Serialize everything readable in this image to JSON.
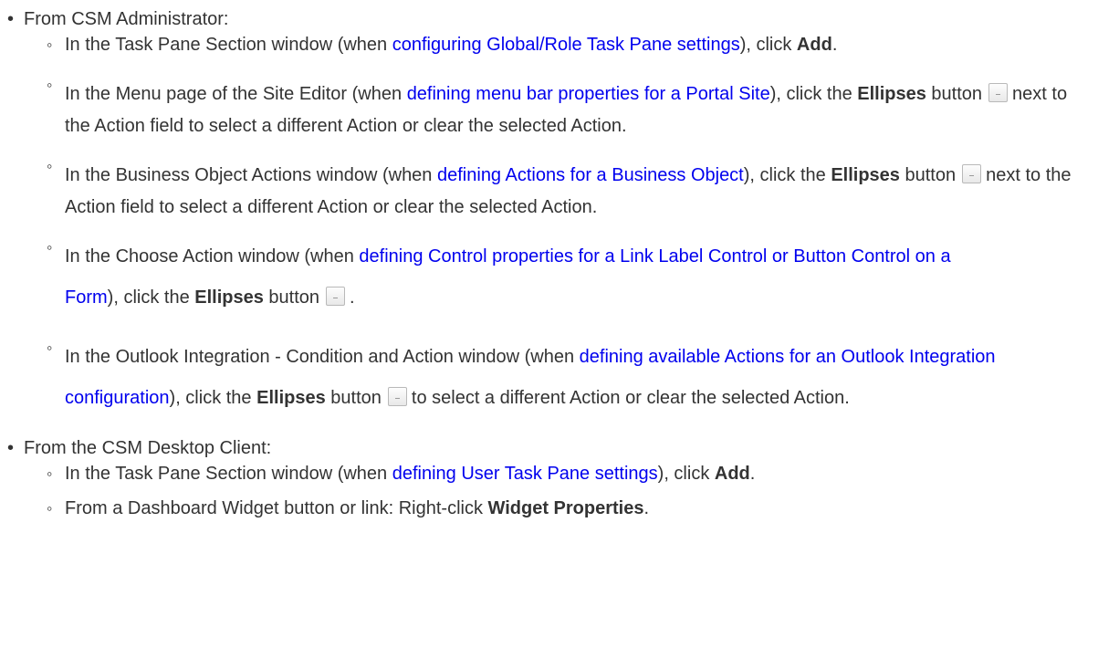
{
  "sections": [
    {
      "label": "From CSM Administrator:",
      "items": [
        {
          "pre": "In the Task Pane Section window (when ",
          "link": "configuring Global/Role Task Pane settings",
          "mid": "), click ",
          "bold": "Add",
          "post": "."
        },
        {
          "pre": "In the Menu page of the Site Editor (when ",
          "link": "defining menu bar properties for a Portal Site",
          "mid": "), click the ",
          "bold": "Ellipses",
          "btn_label": " button",
          "post": "next to the Action field to select a different Action or clear the selected Action."
        },
        {
          "pre": "In the Business Object Actions window (when ",
          "link": "defining Actions for a Business Object",
          "mid": "), click the ",
          "bold": "Ellipses",
          "btn_label": " button",
          "post": "next to the Action field to select a different Action or clear the selected Action."
        },
        {
          "pre": "In the Choose Action window (when ",
          "link": "defining Control properties for a Link Label Control or Button Control on a Form",
          "mid": "), click the ",
          "bold": "Ellipses",
          "btn_label": " button",
          "post": "."
        },
        {
          "pre": "In the Outlook Integration - Condition and Action window (when ",
          "link": "defining available Actions for an Outlook Integration configuration",
          "mid": "), click the ",
          "bold": "Ellipses",
          "btn_label": " button",
          "post": "to select a different Action or clear the selected Action."
        }
      ]
    },
    {
      "label": "From the CSM Desktop Client:",
      "items": [
        {
          "pre": "In the Task Pane Section window (when ",
          "link": "defining User Task Pane settings",
          "mid": "), click ",
          "bold": "Add",
          "post": "."
        },
        {
          "pre": "From a Dashboard Widget button or link: Right-click ",
          "bold": "Widget Properties",
          "post": "."
        }
      ]
    }
  ],
  "icons": {
    "ellipses_button": "ellipsis-button-icon"
  }
}
